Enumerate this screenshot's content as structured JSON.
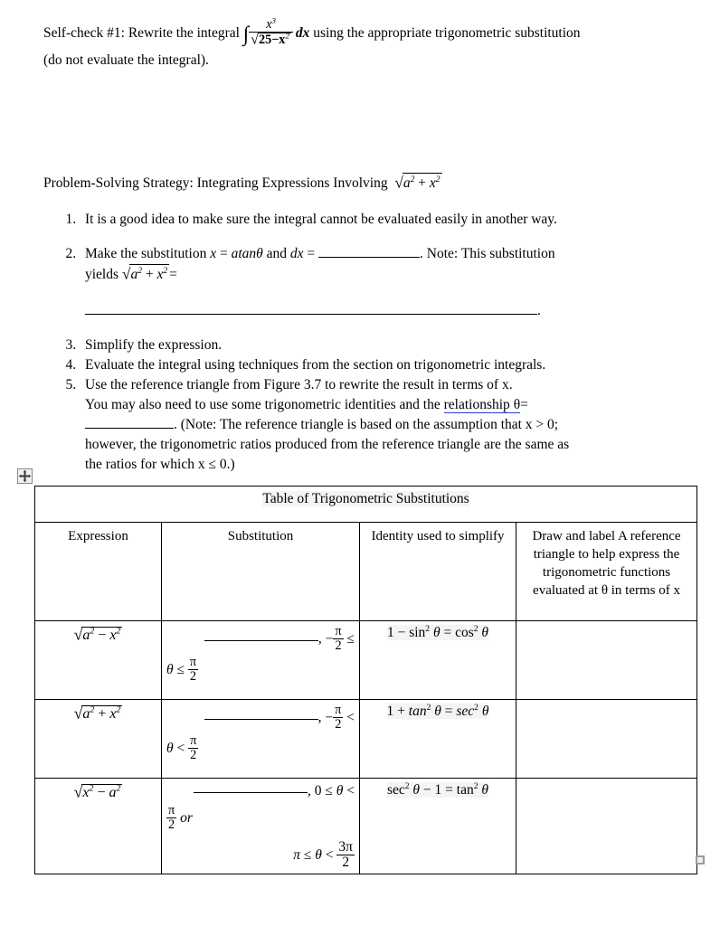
{
  "document": {
    "self_check": {
      "label": "Self-check #1:",
      "line1_pre": "Rewrite the integral",
      "integral_symbol": "∫",
      "numerator": "x",
      "numerator_exp": "3",
      "denominator_radicand": "25−x",
      "denominator_exp": "2",
      "differential": "dx",
      "line1_post": "using the appropriate trigonometric substitution",
      "line2": "(do not evaluate the integral)."
    },
    "strategy_heading": {
      "text": "Problem-Solving Strategy: Integrating Expressions Involving",
      "expression_a": "a",
      "expression_a_exp": "2",
      "expression_op": "+",
      "expression_x": "x",
      "expression_x_exp": "2"
    },
    "steps": [
      {
        "id": "step-1",
        "text": "It is a good idea to make sure the integral cannot be evaluated easily in another way."
      },
      {
        "id": "step-2",
        "pre": "Make the substitution",
        "var_x": "x",
        "equals1": "=",
        "substitution": "atanθ",
        "mid": "and",
        "var_dx": "dx",
        "equals2": "=",
        "post": ". Note: This substitution",
        "line2_pre": "yields",
        "radicand_a": "a",
        "radicand_a_exp": "2",
        "radicand_op": "+",
        "radicand_x": "x",
        "radicand_x_exp": "2",
        "line2_post": "=",
        "trailing_period": "."
      },
      {
        "id": "step-3",
        "text": "Simplify the expression."
      },
      {
        "id": "step-4",
        "text": "Evaluate the integral using techniques from the section on trigonometric integrals."
      },
      {
        "id": "step-5",
        "line1": "Use the reference triangle from Figure 3.7 to rewrite the result in terms of x.",
        "line2_pre": "You may also need to use some trigonometric identities and the",
        "line2_link": "relationship",
        "line2_theta": "θ",
        "line2_equals": "=",
        "line3_post": ". (Note: The reference triangle is based on the assumption that x > 0;",
        "line4": "however, the trigonometric ratios produced from the reference triangle are the same as",
        "line5": "the ratios for which x ≤ 0.)"
      }
    ],
    "table": {
      "title": "Table of Trigonometric Substitutions",
      "columns": [
        {
          "id": "expression",
          "label": "Expression"
        },
        {
          "id": "substitution",
          "label": "Substitution"
        },
        {
          "id": "identity",
          "label": "Identity used to simplify"
        },
        {
          "id": "draw",
          "label": "Draw and label A reference triangle to help express the trigonometric functions evaluated at θ in terms of x"
        }
      ],
      "rows": [
        {
          "id": "row-1",
          "expression": {
            "a": "a",
            "a_exp": "2",
            "op": "−",
            "x": "x",
            "x_exp": "2"
          },
          "substitution": {
            "blank": "",
            "comma": ",",
            "sign": "−",
            "bound1_num": "π",
            "bound1_den": "2",
            "rel1": "≤",
            "theta": "θ",
            "rel2": "≤",
            "bound2_num": "π",
            "bound2_den": "2"
          },
          "identity": {
            "lhs_const": "1",
            "lhs_op": "−",
            "lhs_fn": "sin",
            "lhs_exp": "2",
            "lhs_theta": "θ",
            "eq": "=",
            "rhs_fn": "cos",
            "rhs_exp": "2",
            "rhs_theta": "θ"
          },
          "draw": ""
        },
        {
          "id": "row-2",
          "expression": {
            "a": "a",
            "a_exp": "2",
            "op": "+",
            "x": "x",
            "x_exp": "2"
          },
          "substitution": {
            "blank": "",
            "comma": ",",
            "sign": "−",
            "bound1_num": "π",
            "bound1_den": "2",
            "rel1": "<",
            "theta": "θ",
            "rel2": "<",
            "bound2_num": "π",
            "bound2_den": "2"
          },
          "identity": {
            "lhs_const": "1",
            "lhs_op": "+",
            "lhs_fn": "tan",
            "lhs_exp": "2",
            "lhs_theta": "θ",
            "eq": "=",
            "rhs_fn": "sec",
            "rhs_exp": "2",
            "rhs_theta": "θ"
          },
          "draw": ""
        },
        {
          "id": "row-3",
          "expression": {
            "a": "x",
            "a_exp": "2",
            "op": "−",
            "x": "a",
            "x_exp": "2"
          },
          "substitution": {
            "blank": "",
            "comma": ",",
            "zero": "0",
            "rel1": "≤",
            "theta": "θ",
            "rel2": "<",
            "bound1_num": "π",
            "bound1_den": "2",
            "or": "or",
            "pi": "π",
            "rel3": "≤",
            "theta2": "θ",
            "rel4": "<",
            "bound2_num": "3π",
            "bound2_den": "2"
          },
          "identity": {
            "lhs_fn": "sec",
            "lhs_exp": "2",
            "lhs_theta": "θ",
            "lhs_op": "−",
            "lhs_const": "1",
            "eq": "=",
            "rhs_fn": "tan",
            "rhs_exp": "2",
            "rhs_theta": "θ"
          },
          "draw": ""
        }
      ]
    },
    "handles": {
      "move_handle_icon": "table-move-handle-icon",
      "resize_handle_icon": "table-resize-handle-icon"
    },
    "colors": {
      "text": "#000000",
      "page_background": "#ffffff",
      "link_underline": "#2b3fd6",
      "table_border": "#000000",
      "highlight": "#f4f4f4",
      "handle_border": "#8a8a8a"
    }
  }
}
